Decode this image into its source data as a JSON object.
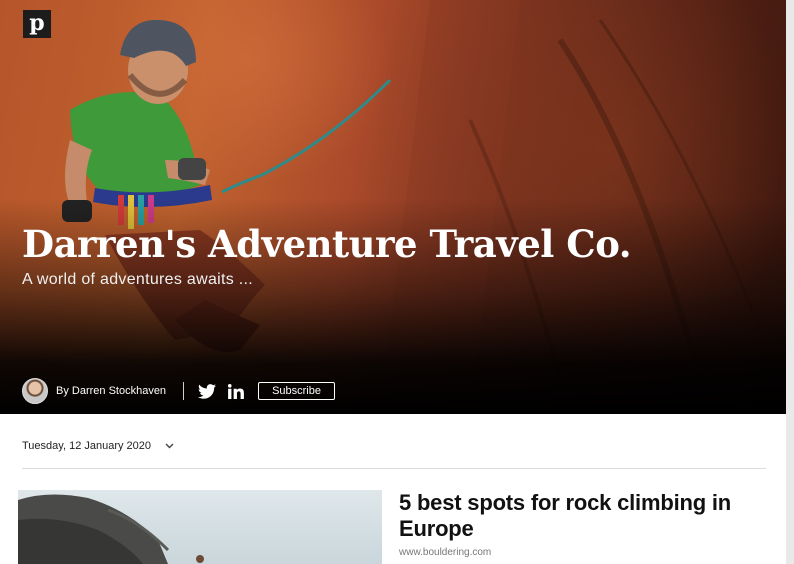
{
  "blog": {
    "logo": "p",
    "title": "Darren's Adventure Travel Co.",
    "subtitle": "A world of adventures awaits ...",
    "author": "By Darren Stockhaven",
    "subscribe_label": "Subscribe"
  },
  "icons": {
    "twitter": "twitter-icon",
    "linkedin": "linkedin-icon",
    "date_menu": "chevron-down-icon"
  },
  "date": "Tuesday, 12 January 2020",
  "articles": [
    {
      "title": "5 best spots for rock climbing in Europe",
      "source": "www.bouldering.com"
    }
  ],
  "colors": {
    "hero_text": "#ffffff",
    "logo_bg": "#1c1c1c",
    "article_title": "#111111",
    "source_text": "#777777"
  }
}
